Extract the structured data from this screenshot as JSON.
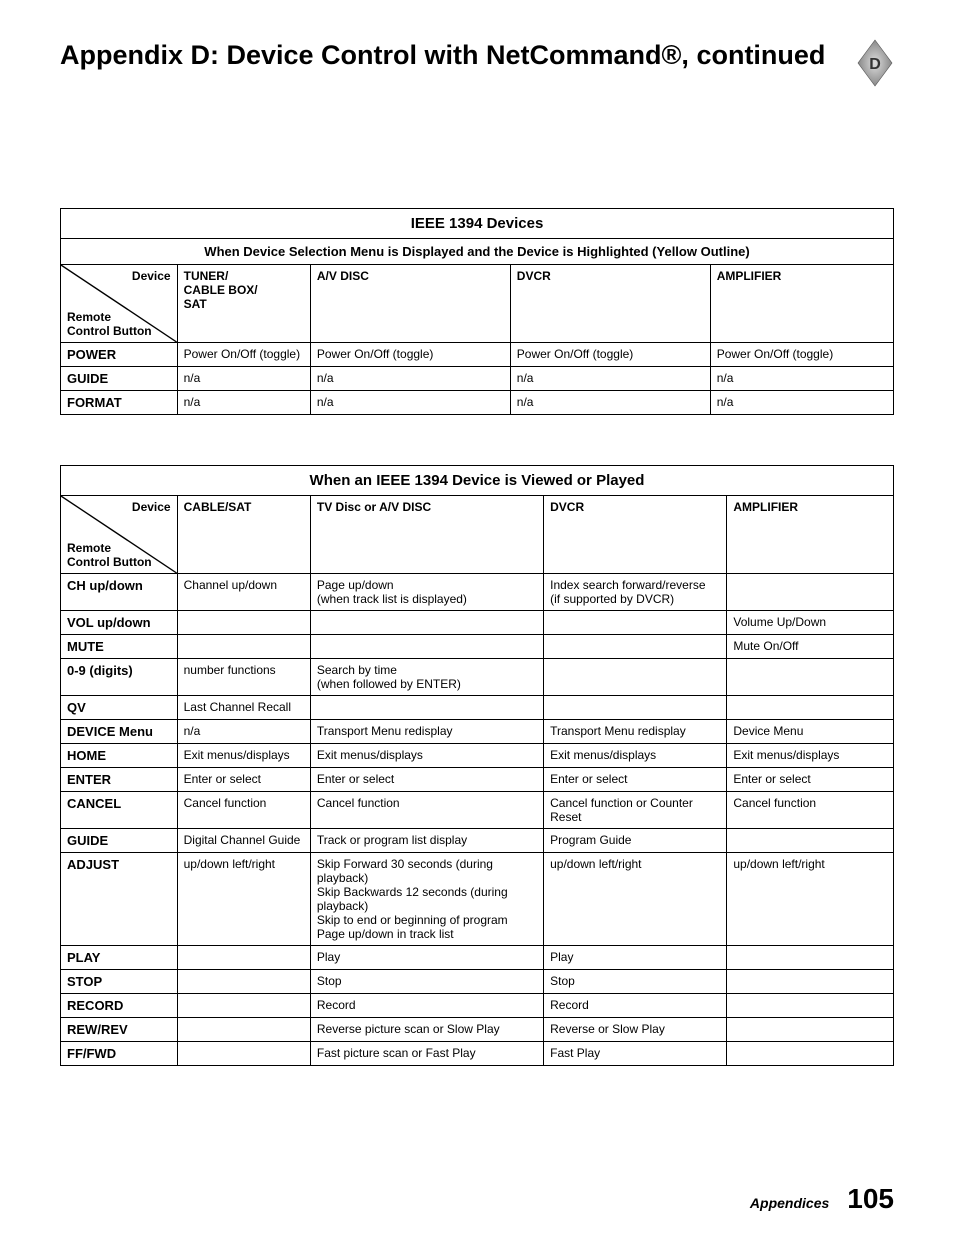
{
  "header": {
    "title": "Appendix D:  Device Control with NetCommand®, continued",
    "badge_letter": "D"
  },
  "table1": {
    "title": "IEEE 1394 Devices",
    "subtitle": "When Device Selection Menu is Displayed and the Device is Highlighted (Yellow Outline)",
    "diag_top": "Device",
    "diag_bottom_1": "Remote",
    "diag_bottom_2": "Control  Button",
    "col_headers": [
      "TUNER/\nCABLE BOX/\nSAT",
      "A/V DISC",
      "DVCR",
      "AMPLIFIER"
    ],
    "rows": [
      {
        "label": "POWER",
        "cells": [
          "Power On/Off (toggle)",
          "Power On/Off (toggle)",
          "Power On/Off (toggle)",
          "Power On/Off (toggle)"
        ]
      },
      {
        "label": "GUIDE",
        "cells": [
          "n/a",
          "n/a",
          "n/a",
          "n/a"
        ]
      },
      {
        "label": "FORMAT",
        "cells": [
          "n/a",
          "n/a",
          "n/a",
          "n/a"
        ]
      }
    ]
  },
  "table2": {
    "title": "When an IEEE 1394 Device is Viewed or Played",
    "diag_top": "Device",
    "diag_bottom_1": "Remote",
    "diag_bottom_2": "Control  Button",
    "col_headers": [
      "CABLE/SAT",
      "TV Disc or A/V DISC",
      "DVCR",
      "AMPLIFIER"
    ],
    "rows": [
      {
        "label": "CH up/down",
        "cells": [
          "Channel up/down",
          "Page up/down\n(when track list is displayed)",
          "Index search forward/reverse\n(if supported by DVCR)",
          ""
        ]
      },
      {
        "label": "VOL up/down",
        "cells": [
          "",
          "",
          "",
          "Volume Up/Down"
        ]
      },
      {
        "label": "MUTE",
        "cells": [
          "",
          "",
          "",
          "Mute On/Off"
        ]
      },
      {
        "label": "0-9 (digits)",
        "cells": [
          "number functions",
          "Search by time\n(when followed by ENTER)",
          "",
          ""
        ]
      },
      {
        "label": "QV",
        "cells": [
          "Last Channel Recall",
          "",
          "",
          ""
        ]
      },
      {
        "label": "DEVICE Menu",
        "cells": [
          "n/a",
          "Transport Menu redisplay",
          "Transport Menu redisplay",
          "Device Menu"
        ]
      },
      {
        "label": "HOME",
        "cells": [
          "Exit menus/displays",
          "Exit menus/displays",
          "Exit menus/displays",
          "Exit menus/displays"
        ]
      },
      {
        "label": "ENTER",
        "cells": [
          "Enter or select",
          "Enter or select",
          "Enter or select",
          "Enter or select"
        ]
      },
      {
        "label": "CANCEL",
        "cells": [
          "Cancel function",
          "Cancel function",
          "Cancel function or Counter Reset",
          "Cancel function"
        ]
      },
      {
        "label": "GUIDE",
        "cells": [
          "Digital Channel Guide",
          "Track or program list display",
          "Program Guide",
          ""
        ]
      },
      {
        "label": "ADJUST",
        "cells": [
          "up/down left/right",
          "Skip Forward 30 seconds (during playback)\nSkip Backwards 12 seconds (during playback)\nSkip to end or beginning of program\nPage up/down in track list",
          "up/down left/right",
          "up/down left/right"
        ]
      },
      {
        "label": "PLAY",
        "cells": [
          "",
          "Play",
          "Play",
          ""
        ]
      },
      {
        "label": "STOP",
        "cells": [
          "",
          "Stop",
          "Stop",
          ""
        ]
      },
      {
        "label": "RECORD",
        "cells": [
          "",
          "Record",
          "Record",
          ""
        ]
      },
      {
        "label": "REW/REV",
        "cells": [
          "",
          "Reverse picture scan or Slow Play",
          "Reverse or Slow Play",
          ""
        ]
      },
      {
        "label": "FF/FWD",
        "cells": [
          "",
          "Fast picture scan or Fast Play",
          "Fast Play",
          ""
        ]
      }
    ]
  },
  "footer": {
    "section": "Appendices",
    "page": "105"
  }
}
